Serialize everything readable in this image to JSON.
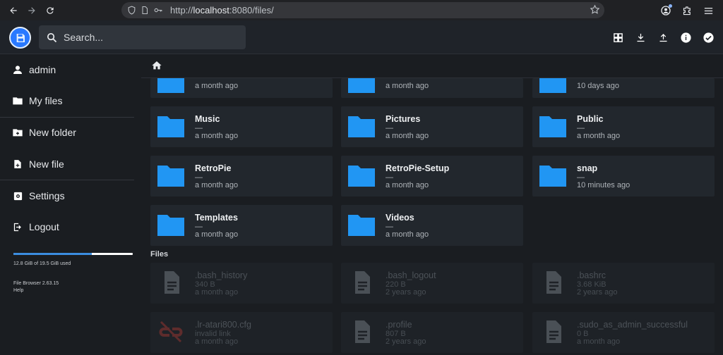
{
  "browser": {
    "url_prefix": "http://",
    "url_host": "localhost",
    "url_rest": ":8080/files/"
  },
  "header": {
    "search_placeholder": "Search...",
    "actions": [
      "grid-view-icon",
      "download-icon",
      "upload-icon",
      "info-icon",
      "check-icon"
    ]
  },
  "sidebar": {
    "user": "admin",
    "my_files": "My files",
    "new_folder": "New folder",
    "new_file": "New file",
    "settings": "Settings",
    "logout": "Logout",
    "usage_text": "12.8 GiB of 19.5 GiB used",
    "usage_fraction": 0.656,
    "version": "File Browser 2.63.15",
    "help": "Help"
  },
  "folders_top": [
    {
      "date": "a month ago"
    },
    {
      "date": "a month ago"
    },
    {
      "date": "10 days ago"
    }
  ],
  "folders": [
    {
      "name": "Music",
      "size": "—",
      "date": "a month ago"
    },
    {
      "name": "Pictures",
      "size": "—",
      "date": "a month ago"
    },
    {
      "name": "Public",
      "size": "—",
      "date": "a month ago"
    },
    {
      "name": "RetroPie",
      "size": "—",
      "date": "a month ago"
    },
    {
      "name": "RetroPie-Setup",
      "size": "—",
      "date": "a month ago"
    },
    {
      "name": "snap",
      "size": "—",
      "date": "10 minutes ago"
    },
    {
      "name": "Templates",
      "size": "—",
      "date": "a month ago"
    },
    {
      "name": "Videos",
      "size": "—",
      "date": "a month ago"
    }
  ],
  "files_label": "Files",
  "files": [
    {
      "name": ".bash_history",
      "size": "340 B",
      "date": "a month ago",
      "icon": "file-icon"
    },
    {
      "name": ".bash_logout",
      "size": "220 B",
      "date": "2 years ago",
      "icon": "file-icon"
    },
    {
      "name": ".bashrc",
      "size": "3.68 KiB",
      "date": "2 years ago",
      "icon": "file-icon"
    },
    {
      "name": ".lr-atari800.cfg",
      "size": "invalid link",
      "date": "a month ago",
      "icon": "broken-link-icon"
    },
    {
      "name": ".profile",
      "size": "807 B",
      "date": "2 years ago",
      "icon": "file-icon"
    },
    {
      "name": ".sudo_as_admin_successful",
      "size": "0 B",
      "date": "a month ago",
      "icon": "file-icon"
    }
  ],
  "colors": {
    "folder": "#2196f3",
    "accent": "#3b8de0",
    "background": "#1a1d21",
    "card": "#22272d"
  }
}
